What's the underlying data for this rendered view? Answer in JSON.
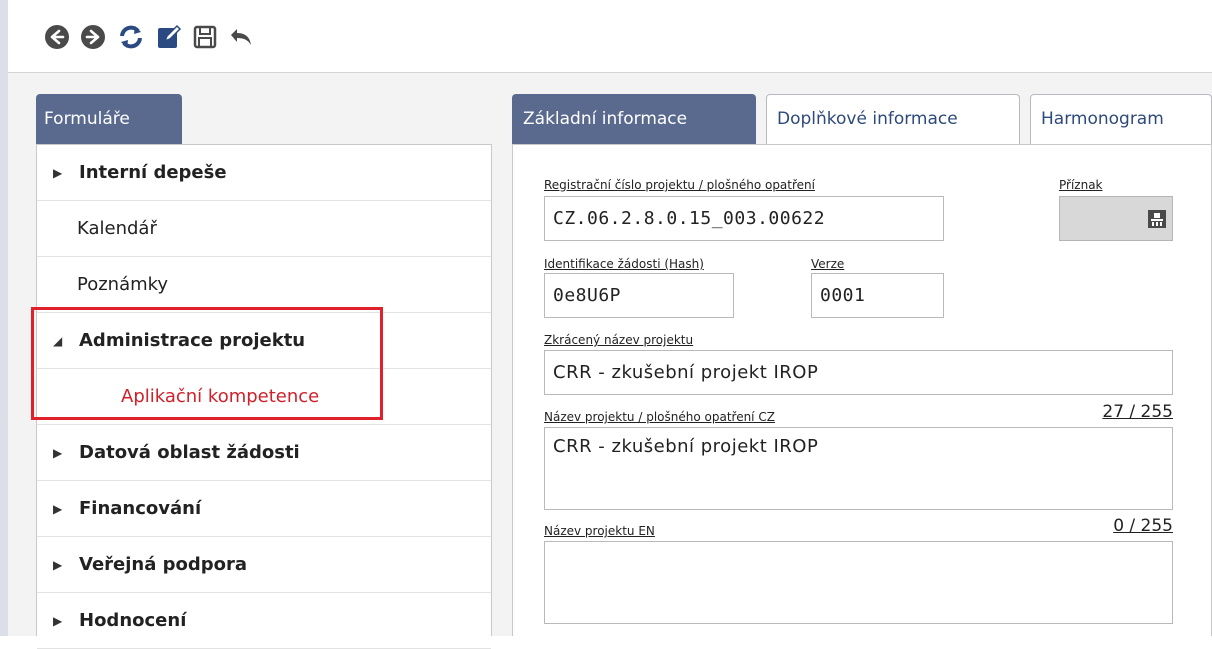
{
  "toolbar": {
    "buttons": [
      {
        "name": "back",
        "icon": "arrow-left-circle-icon"
      },
      {
        "name": "forward",
        "icon": "arrow-right-circle-icon"
      },
      {
        "name": "refresh",
        "icon": "refresh-icon"
      },
      {
        "name": "edit",
        "icon": "edit-icon"
      },
      {
        "name": "save",
        "icon": "save-icon"
      },
      {
        "name": "undo",
        "icon": "undo-icon"
      }
    ]
  },
  "sidebar": {
    "tab_label": "Formuláře",
    "items": [
      {
        "label": "Interní depeše",
        "bold": true,
        "arrow": "▶"
      },
      {
        "label": "Kalendář",
        "bold": false
      },
      {
        "label": "Poznámky",
        "bold": false
      },
      {
        "label": "Administrace projektu",
        "bold": true,
        "arrow": "◢"
      },
      {
        "label": "Aplikační kompetence",
        "sub": true
      },
      {
        "label": "Datová oblast žádosti",
        "bold": true,
        "arrow": "▶"
      },
      {
        "label": "Financování",
        "bold": true,
        "arrow": "▶"
      },
      {
        "label": "Veřejná podpora",
        "bold": true,
        "arrow": "▶"
      },
      {
        "label": "Hodnocení",
        "bold": true,
        "arrow": "▶"
      }
    ]
  },
  "tabs": [
    {
      "label": "Základní informace",
      "active": true
    },
    {
      "label": "Doplňkové informace",
      "active": false
    },
    {
      "label": "Harmonogram",
      "active": false
    }
  ],
  "form": {
    "reg_number_label": "Registrační číslo projektu / plošného opatření",
    "reg_number_value": "CZ.06.2.8.0.15_003.00622",
    "flag_label": "Příznak",
    "hash_label": "Identifikace žádosti (Hash)",
    "hash_value": "0e8U6P",
    "version_label": "Verze",
    "version_value": "0001",
    "short_name_label": "Zkrácený název projektu",
    "short_name_value": "CRR - zkušební projekt IROP",
    "name_cz_label": "Název projektu / plošného opatření CZ",
    "name_cz_counter": "27 / 255",
    "name_cz_value": "CRR - zkušební projekt IROP",
    "name_en_label": "Název projektu EN",
    "name_en_counter": "0 / 255",
    "name_en_value": ""
  },
  "colors": {
    "tab_active": "#5a6a8f",
    "highlight": "#e0202a",
    "sub_item": "#d0202a"
  }
}
